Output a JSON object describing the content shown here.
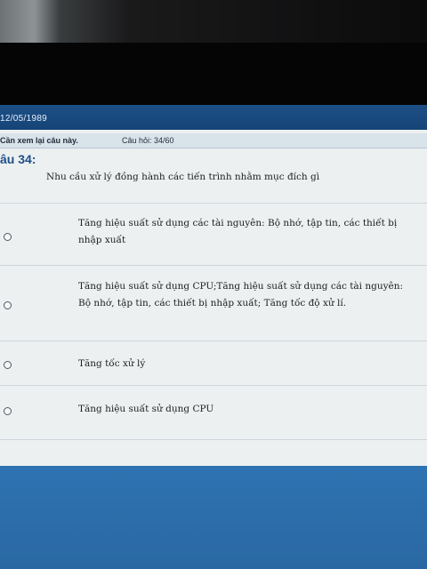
{
  "header": {
    "date": "12/05/1989"
  },
  "infobar": {
    "review_label": "Cần xem lại câu này.",
    "question_counter": "Câu hỏi: 34/60"
  },
  "question": {
    "title": "âu 34:",
    "text": "Nhu cầu xử lý đồng hành các tiến trình nhằm mục đích gì"
  },
  "options": [
    {
      "label": "Tăng hiệu suất sử dụng các tài nguyên: Bộ nhớ, tập tin, các thiết bị nhập xuất"
    },
    {
      "label": "Tăng hiệu suất sử dụng CPU;Tăng hiệu suất sử dụng các tài nguyên: Bộ nhớ, tập tin, các thiết bị nhập xuất; Tăng tốc độ xử lí."
    },
    {
      "label": "Tăng tốc xử lý"
    },
    {
      "label": "Tăng hiệu suất sử dụng CPU"
    }
  ]
}
